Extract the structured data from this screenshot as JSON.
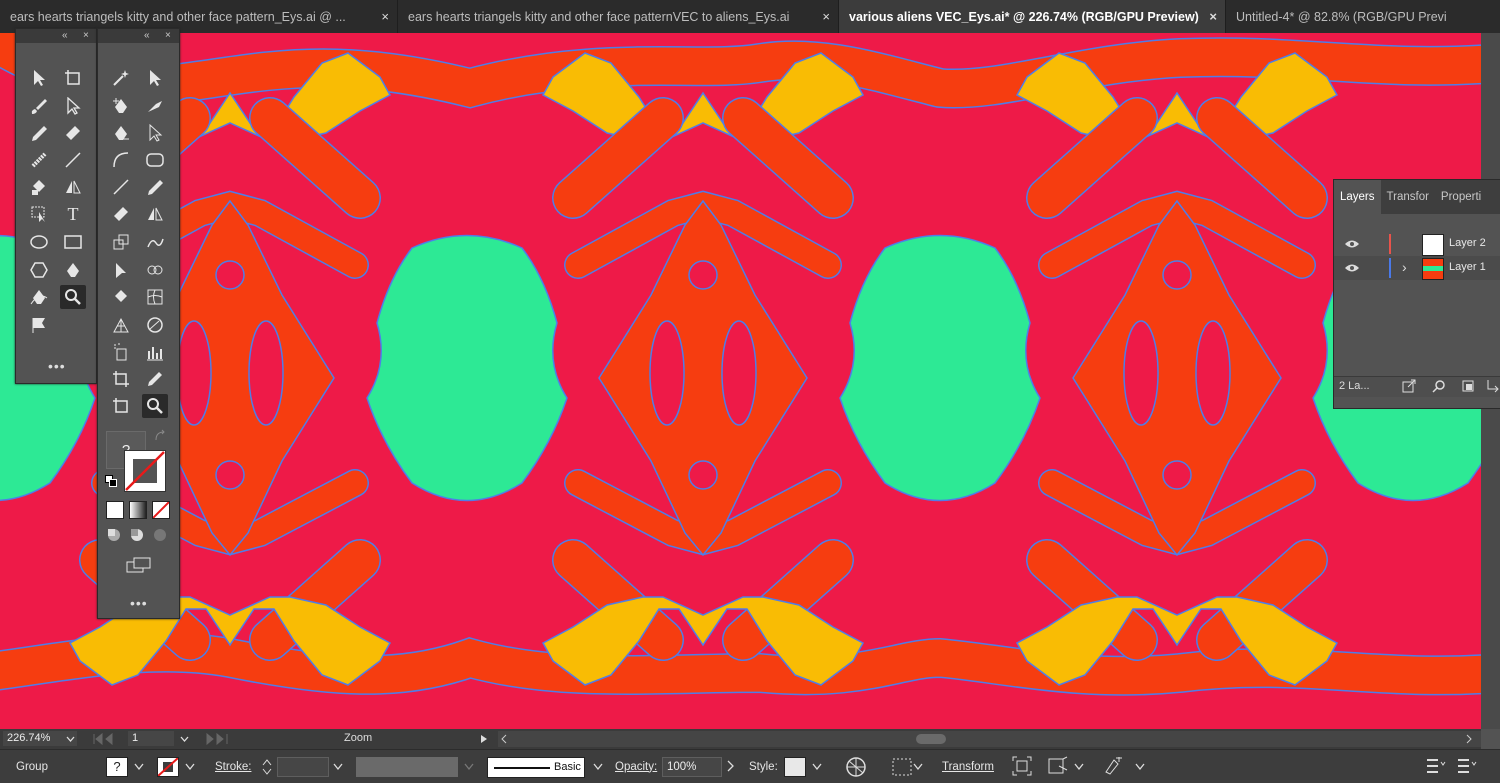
{
  "tabs": [
    {
      "title": "ears hearts triangels kitty and other face pattern_Eys.ai @ ...",
      "active": false
    },
    {
      "title": "ears hearts triangels kitty and other face patternVEC to aliens_Eys.ai",
      "active": false
    },
    {
      "title": "various aliens VEC_Eys.ai* @ 226.74% (RGB/GPU Preview)",
      "active": true
    },
    {
      "title": "Untitled-4* @ 82.8% (RGB/GPU Previ",
      "active": false
    }
  ],
  "tab_close_glyph": "×",
  "colors": {
    "canvas_bg": "#ee1a48",
    "orange": "#f63d10",
    "yellow": "#f9bc04",
    "green": "#2de995",
    "path": "#4f7de8"
  },
  "toolbar": {
    "collapse_glyph": "«",
    "close_glyph": "×",
    "more_glyph": "•••",
    "help_glyph": "?",
    "type_tool_glyph": "T"
  },
  "layers_panel": {
    "tabs": [
      "Layers",
      "Transfor",
      "Properti"
    ],
    "layers": [
      {
        "name": "Layer 2",
        "color": "#e8534b",
        "thumb": "white"
      },
      {
        "name": "Layer 1",
        "color": "#4a79e8",
        "thumb": "pattern",
        "expanded_glyph": "›"
      }
    ],
    "footer_count": "2 La..."
  },
  "status_bar": {
    "zoom": "226.74%",
    "artboard": "1",
    "label": "Zoom"
  },
  "control_bar": {
    "selection": "Group",
    "stroke_label": "Stroke:",
    "brush_label": "Basic",
    "opacity_label": "Opacity:",
    "opacity_value": "100%",
    "style_label": "Style:",
    "transform_label": "Transform",
    "fill_unknown_glyph": "?"
  }
}
